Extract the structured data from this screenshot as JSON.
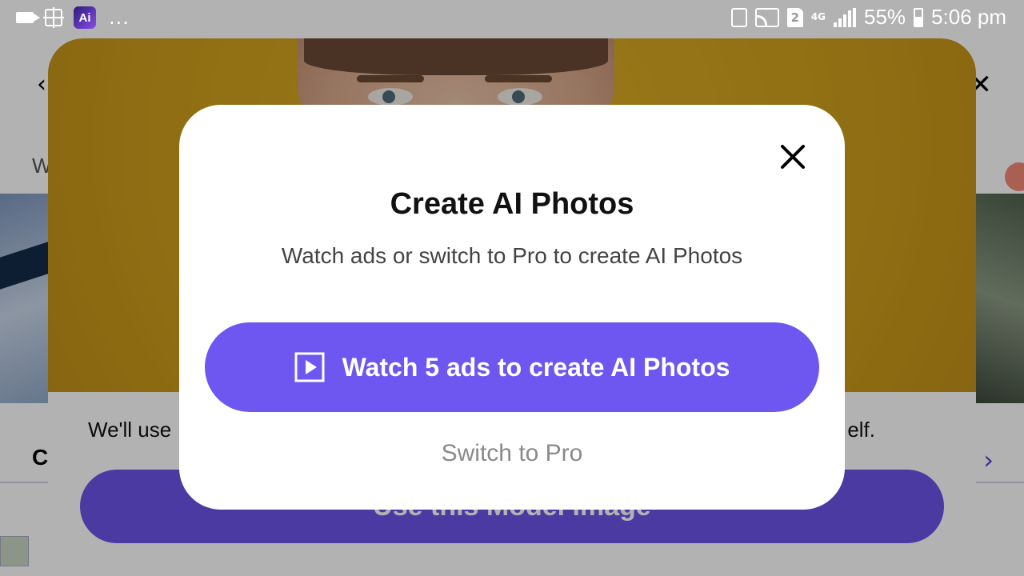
{
  "status_bar": {
    "app_icon_text": "Ai",
    "overflow_dots": "...",
    "sim_slot": "2",
    "network_type": "4G",
    "battery_percent": "55%",
    "time": "5:06 pm"
  },
  "background_page": {
    "back_glyph": "‹",
    "close_glyph": "✕",
    "section_label_fragment": "W",
    "section_heading_fragment": "C",
    "next_glyph": "›"
  },
  "sheet": {
    "description_start": "We'll use",
    "description_end": "elf.",
    "cta_label": "Use this Model Image"
  },
  "dialog": {
    "title": "Create AI Photos",
    "subtitle": "Watch ads or switch to Pro to create AI Photos",
    "primary_button": "Watch 5 ads to create AI Photos",
    "secondary_button": "Switch to Pro"
  },
  "colors": {
    "accent": "#6d57f0",
    "sheet_photo_background": "#d0a11e",
    "dim_overlay": "rgba(0,0,0,0.30)"
  },
  "icons": [
    "video-camera-icon",
    "screen-mirror-icon",
    "app-icon",
    "clipboard-icon",
    "cast-icon",
    "sim-icon",
    "signal-icon",
    "battery-icon",
    "play-icon",
    "close-icon"
  ]
}
